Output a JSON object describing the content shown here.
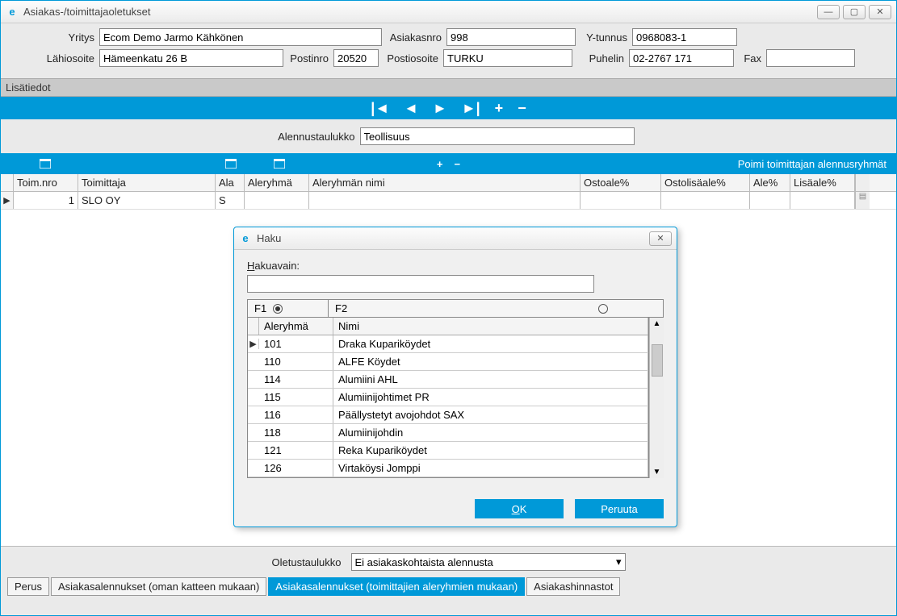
{
  "window": {
    "title": "Asiakas-/toimittajaoletukset",
    "app_icon_letter": "e"
  },
  "form": {
    "yritys_label": "Yritys",
    "yritys_value": "Ecom Demo Jarmo Kähkönen",
    "asiakasnro_label": "Asiakasnro",
    "asiakasnro_value": "998",
    "ytunnus_label": "Y-tunnus",
    "ytunnus_value": "0968083-1",
    "lahiosoite_label": "Lähiosoite",
    "lahiosoite_value": "Hämeenkatu 26 B",
    "postinro_label": "Postinro",
    "postinro_value": "20520",
    "postiosoite_label": "Postiosoite",
    "postiosoite_value": "TURKU",
    "puhelin_label": "Puhelin",
    "puhelin_value": "02-2767 171",
    "fax_label": "Fax",
    "fax_value": ""
  },
  "section": {
    "lisatiedot": "Lisätiedot"
  },
  "alennustaulukko_label": "Alennustaulukko",
  "alennustaulukko_value": "Teollisuus",
  "bluebar2": {
    "right_link": "Poimi toimittajan alennusryhmät"
  },
  "grid": {
    "headers": {
      "toimnro": "Toim.nro",
      "toimittaja": "Toimittaja",
      "ala": "Ala",
      "aleryhma": "Aleryhmä",
      "aleryhman_nimi": "Aleryhmän nimi",
      "ostoale": "Ostoale%",
      "ostolisaale": "Ostolisäale%",
      "ale": "Ale%",
      "lisaale": "Lisäale%"
    },
    "rows": [
      {
        "toimnro": "1",
        "toimittaja": "SLO OY",
        "ala": "S",
        "aleryhma": "",
        "aleryhman_nimi": "",
        "ostoale": "",
        "ostolisaale": "",
        "ale": "",
        "lisaale": ""
      }
    ]
  },
  "oletustaulukko_label": "Oletustaulukko",
  "oletustaulukko_value": "Ei asiakaskohtaista alennusta",
  "tabs": {
    "perus": "Perus",
    "oman": "Asiakasalennukset (oman katteen mukaan)",
    "toim": "Asiakasalennukset (toimittajien aleryhmien mukaan)",
    "hinn": "Asiakashinnastot"
  },
  "dialog": {
    "title": "Haku",
    "hakuavain_label": "Hakuavain:",
    "hakuavain_value": "",
    "f1": "F1",
    "f2": "F2",
    "col_aleryhma": "Aleryhmä",
    "col_nimi": "Nimi",
    "rows": [
      {
        "code": "101",
        "name": "Draka Kupariköydet"
      },
      {
        "code": "110",
        "name": "ALFE Köydet"
      },
      {
        "code": "114",
        "name": "Alumiini AHL"
      },
      {
        "code": "115",
        "name": "Alumiinijohtimet PR"
      },
      {
        "code": "116",
        "name": "Päällystetyt avojohdot SAX"
      },
      {
        "code": "118",
        "name": "Alumiinijohdin"
      },
      {
        "code": "121",
        "name": "Reka Kupariköydet"
      },
      {
        "code": "126",
        "name": "Virtaköysi Jomppi"
      }
    ],
    "ok": "OK",
    "cancel": "Peruuta"
  }
}
